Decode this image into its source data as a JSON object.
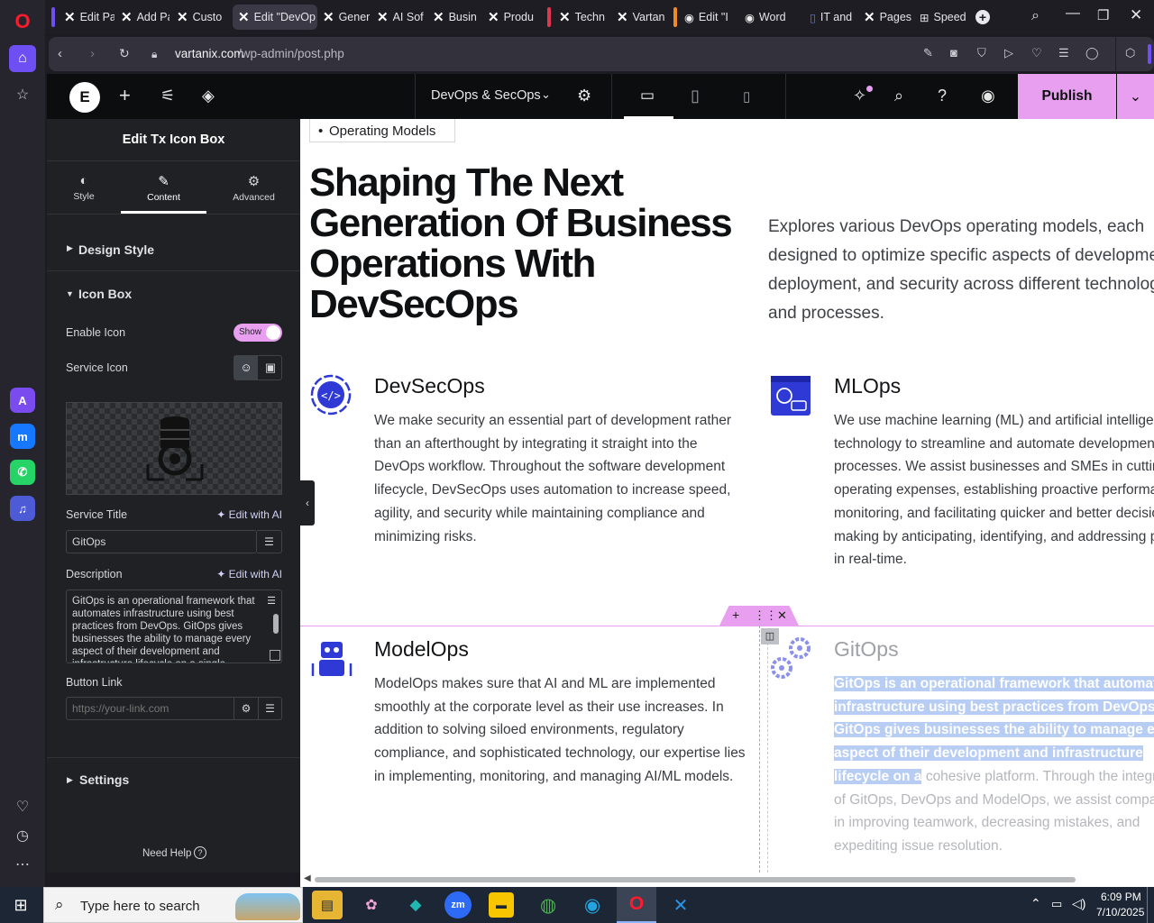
{
  "browser": {
    "tabs": [
      {
        "label": "Edit Pa",
        "icon": "x-logo-icon"
      },
      {
        "label": "Add Pa",
        "icon": "x-logo-icon"
      },
      {
        "label": "Custo",
        "icon": "x-logo-icon"
      },
      {
        "label": "Edit \"DevOp",
        "icon": "x-logo-icon",
        "active": true
      },
      {
        "label": "Gener",
        "icon": "x-logo-icon"
      },
      {
        "label": "AI Sof",
        "icon": "x-logo-icon"
      },
      {
        "label": "Busin",
        "icon": "x-logo-icon"
      },
      {
        "label": "Produ",
        "icon": "x-logo-icon"
      },
      {
        "label": "Techn",
        "icon": "x-logo-icon"
      },
      {
        "label": "Vartan",
        "icon": "x-logo-icon"
      },
      {
        "label": "Edit \"I",
        "icon": "wordpress-icon"
      },
      {
        "label": "Word",
        "icon": "wordpress-icon"
      },
      {
        "label": "IT and",
        "icon": "document-icon"
      },
      {
        "label": "Pages",
        "icon": "x-logo-icon"
      },
      {
        "label": "Speed",
        "icon": "grid-icon"
      }
    ],
    "url_domain": "vartanix.com",
    "url_path": "/wp-admin/post.php"
  },
  "editor": {
    "page_name": "DevOps & SecOps",
    "publish_label": "Publish"
  },
  "panel": {
    "title": "Edit Tx Icon Box",
    "tabs": [
      {
        "label": "Style",
        "icon": "half-circle-icon"
      },
      {
        "label": "Content",
        "icon": "pencil-icon"
      },
      {
        "label": "Advanced",
        "icon": "gear-icon"
      }
    ],
    "sections": {
      "design_style": "Design Style",
      "icon_box": "Icon Box",
      "settings": "Settings"
    },
    "enable_icon_label": "Enable Icon",
    "enable_icon_toggle": "Show",
    "service_icon_label": "Service Icon",
    "service_title_label": "Service Title",
    "edit_with_ai": "Edit with AI",
    "service_title_value": "GitOps",
    "description_label": "Description",
    "description_value": "GitOps is an operational framework that automates infrastructure using best practices from DevOps. GitOps gives businesses the ability to manage every aspect of their development and infrastructure lifecycle on a single",
    "button_link_label": "Button Link",
    "button_link_placeholder": "https://your-link.com",
    "need_help": "Need Help"
  },
  "canvas": {
    "breadcrumb_tag": "Operating Models",
    "heading": "Shaping The Next Generation Of Business Operations With DevSecOps",
    "intro": "Explores various DevOps operating models, each designed to optimize specific aspects of development, deployment, and security across different technologies and processes.",
    "cards": [
      {
        "title": "DevSecOps",
        "desc": "We make security an essential part of development rather than an afterthought by integrating it straight into the DevOps workflow. Throughout the software development lifecycle, DevSecOps uses automation to increase speed, agility, and security while maintaining compliance and minimizing risks."
      },
      {
        "title": "MLOps",
        "desc": "We use machine learning (ML) and artificial intelligence (AI) technology to streamline and automate development processes. We assist businesses and SMEs in cutting operating expenses, establishing proactive performance monitoring, and facilitating quicker and better decision making by anticipating, identifying, and addressing problems in real-time."
      },
      {
        "title": "ModelOps",
        "desc": "ModelOps makes sure that AI and ML are implemented smoothly at the corporate level as their use increases. In addition to solving siloed environments, regulatory compliance, and sophisticated technology, our expertise lies in implementing, monitoring, and managing AI/ML models."
      },
      {
        "title": "GitOps",
        "desc_selected": "GitOps is an operational framework that automates infrastructure using best practices from DevOps. GitOps gives businesses the ability to manage every aspect of their development and infrastructure lifecycle on a",
        "desc_rest": "cohesive platform. Through the integration of GitOps, DevOps and ModelOps, we assist companies in improving teamwork, decreasing mistakes, and expediting issue resolution."
      }
    ]
  },
  "taskbar": {
    "search_placeholder": "Type here to search",
    "time": "6:09 PM",
    "date": "7/10/2025"
  },
  "colors": {
    "accent_purple": "#e99ff0",
    "icon_blue": "#2e39d6",
    "selection": "#b7cdf3"
  }
}
